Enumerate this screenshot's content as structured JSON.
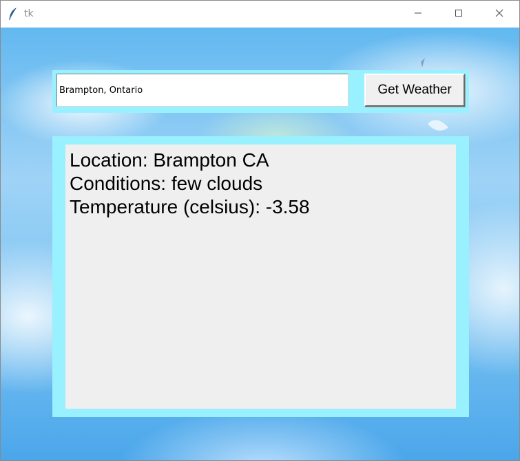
{
  "window": {
    "title": "tk",
    "controls": {
      "minimize": "minimize-icon",
      "maximize": "maximize-icon",
      "close": "close-icon"
    }
  },
  "search": {
    "value": "Brampton, Ontario",
    "button_label": "Get Weather"
  },
  "results": {
    "location": "Location: Brampton CA",
    "conditions": "Conditions: few clouds",
    "temperature": "Temperature (celsius): -3.58"
  },
  "colors": {
    "frame": "#99f0ff",
    "results_background": "#efefef"
  }
}
